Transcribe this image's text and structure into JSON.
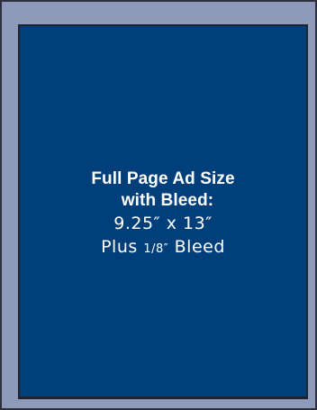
{
  "ad": {
    "title_line1": "Full Page Ad Size",
    "title_line2": "with Bleed:",
    "dimensions": "9.25″ x 13″",
    "bleed_prefix": "Plus",
    "bleed_amount": "1/8″",
    "bleed_suffix": "Bleed"
  },
  "colors": {
    "background": "#8f9abb",
    "panel": "#003f7a",
    "text": "#ffffff"
  }
}
